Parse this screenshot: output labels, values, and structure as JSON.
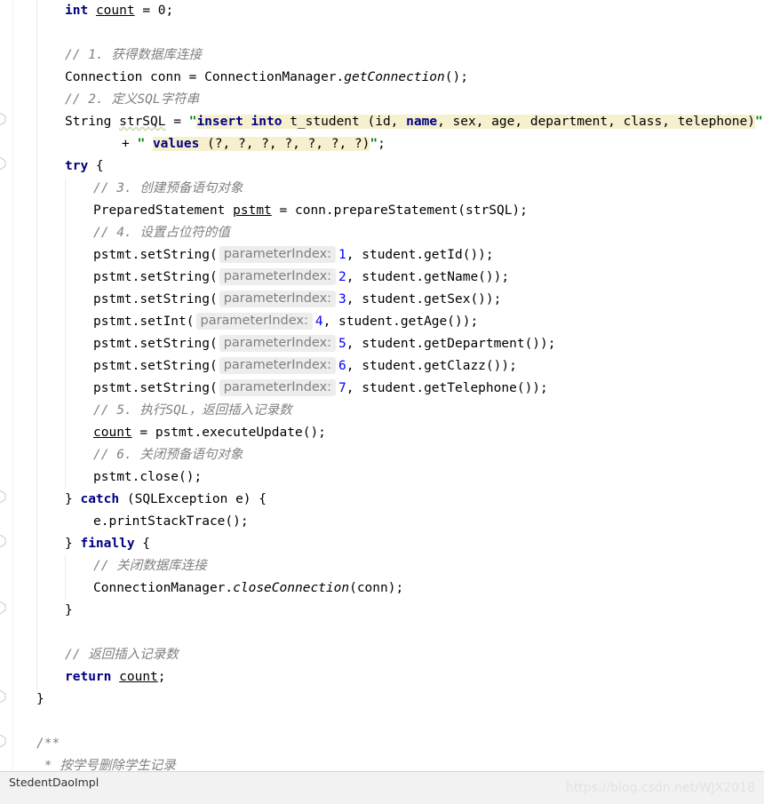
{
  "editor": {
    "lines": {
      "l01": {
        "kw": "int",
        "var": "count",
        "rest": " = 0;"
      },
      "l02": "// 1. 获得数据库连接",
      "l03": {
        "a": "Connection conn = ConnectionManager.",
        "b": "getConnection",
        "c": "();"
      },
      "l04": "// 2. 定义SQL字符串",
      "l05": {
        "a": "String ",
        "b": "strSQL",
        "c": " = ",
        "q1": "\"",
        "k1": "insert into",
        "d": " t_student (id, ",
        "k2": "name",
        "e": ", sex, age, department, class, telephone)",
        "q2": "\""
      },
      "l06": {
        "a": "+ ",
        "q1": "\" ",
        "k1": "values",
        "d": " (?, ?, ?, ?, ?, ?, ?)",
        "q2": "\"",
        "c": ";"
      },
      "l07": {
        "kw": "try",
        "rest": " {"
      },
      "l08": "// 3. 创建预备语句对象",
      "l09": {
        "a": "PreparedStatement ",
        "b": "pstmt",
        "c": " = conn.prepareStatement(strSQL);"
      },
      "l10": "// 4. 设置占位符的值",
      "l11": {
        "a": "pstmt.setString(",
        "hint": "parameterIndex:",
        "n": "1",
        "c": ", student.getId());"
      },
      "l12": {
        "a": "pstmt.setString(",
        "hint": "parameterIndex:",
        "n": "2",
        "c": ", student.getName());"
      },
      "l13": {
        "a": "pstmt.setString(",
        "hint": "parameterIndex:",
        "n": "3",
        "c": ", student.getSex());"
      },
      "l14": {
        "a": "pstmt.setInt(",
        "hint": "parameterIndex:",
        "n": "4",
        "c": ", student.getAge());"
      },
      "l15": {
        "a": "pstmt.setString(",
        "hint": "parameterIndex:",
        "n": "5",
        "c": ", student.getDepartment());"
      },
      "l16": {
        "a": "pstmt.setString(",
        "hint": "parameterIndex:",
        "n": "6",
        "c": ", student.getClazz());"
      },
      "l17": {
        "a": "pstmt.setString(",
        "hint": "parameterIndex:",
        "n": "7",
        "c": ", student.getTelephone());"
      },
      "l18": "// 5. 执行SQL，返回插入记录数",
      "l19": {
        "var": "count",
        "rest": " = pstmt.executeUpdate();"
      },
      "l20": "// 6. 关闭预备语句对象",
      "l21": "pstmt.close();",
      "l22": {
        "a": "} ",
        "kw": "catch",
        "c": " (SQLException e) {"
      },
      "l23": "e.printStackTrace();",
      "l24": {
        "a": "} ",
        "kw": "finally",
        "c": " {"
      },
      "l25": "// 关闭数据库连接",
      "l26": {
        "a": "ConnectionManager.",
        "b": "closeConnection",
        "c": "(conn);"
      },
      "l27": "}",
      "l28": "// 返回插入记录数",
      "l29": {
        "kw": "return",
        "sp": " ",
        "var": "count",
        "rest": ";"
      },
      "l30": "}",
      "l31": "/**",
      "l32": " * 按学号删除学生记录"
    }
  },
  "statusbar": {
    "file_tab": "StedentDaoImpl",
    "watermark": "https://blog.csdn.net/WJX2018"
  },
  "colors": {
    "keyword": "#000080",
    "comment": "#808080",
    "string": "#008000",
    "number": "#0000ff",
    "sql_highlight": "#f6f0cf",
    "hint_background": "#ededed"
  }
}
